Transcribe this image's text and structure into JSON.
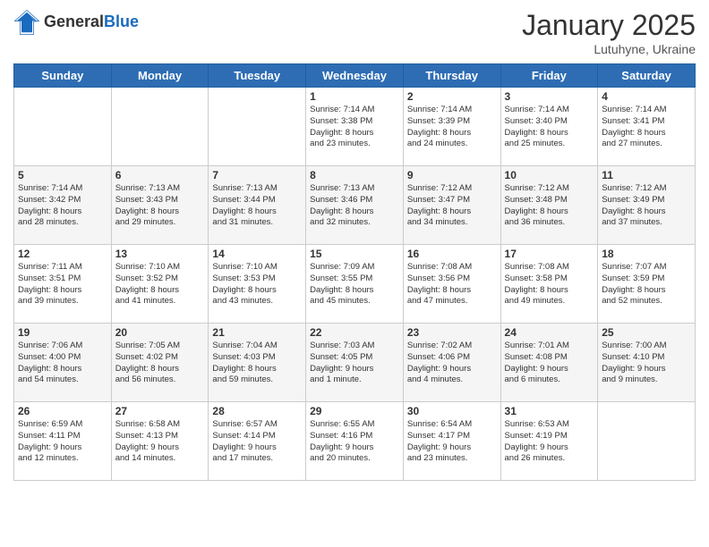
{
  "header": {
    "logo_general": "General",
    "logo_blue": "Blue",
    "month_title": "January 2025",
    "subtitle": "Lutuhyne, Ukraine"
  },
  "weekdays": [
    "Sunday",
    "Monday",
    "Tuesday",
    "Wednesday",
    "Thursday",
    "Friday",
    "Saturday"
  ],
  "weeks": [
    [
      {
        "day": "",
        "info": ""
      },
      {
        "day": "",
        "info": ""
      },
      {
        "day": "",
        "info": ""
      },
      {
        "day": "1",
        "info": "Sunrise: 7:14 AM\nSunset: 3:38 PM\nDaylight: 8 hours\nand 23 minutes."
      },
      {
        "day": "2",
        "info": "Sunrise: 7:14 AM\nSunset: 3:39 PM\nDaylight: 8 hours\nand 24 minutes."
      },
      {
        "day": "3",
        "info": "Sunrise: 7:14 AM\nSunset: 3:40 PM\nDaylight: 8 hours\nand 25 minutes."
      },
      {
        "day": "4",
        "info": "Sunrise: 7:14 AM\nSunset: 3:41 PM\nDaylight: 8 hours\nand 27 minutes."
      }
    ],
    [
      {
        "day": "5",
        "info": "Sunrise: 7:14 AM\nSunset: 3:42 PM\nDaylight: 8 hours\nand 28 minutes."
      },
      {
        "day": "6",
        "info": "Sunrise: 7:13 AM\nSunset: 3:43 PM\nDaylight: 8 hours\nand 29 minutes."
      },
      {
        "day": "7",
        "info": "Sunrise: 7:13 AM\nSunset: 3:44 PM\nDaylight: 8 hours\nand 31 minutes."
      },
      {
        "day": "8",
        "info": "Sunrise: 7:13 AM\nSunset: 3:46 PM\nDaylight: 8 hours\nand 32 minutes."
      },
      {
        "day": "9",
        "info": "Sunrise: 7:12 AM\nSunset: 3:47 PM\nDaylight: 8 hours\nand 34 minutes."
      },
      {
        "day": "10",
        "info": "Sunrise: 7:12 AM\nSunset: 3:48 PM\nDaylight: 8 hours\nand 36 minutes."
      },
      {
        "day": "11",
        "info": "Sunrise: 7:12 AM\nSunset: 3:49 PM\nDaylight: 8 hours\nand 37 minutes."
      }
    ],
    [
      {
        "day": "12",
        "info": "Sunrise: 7:11 AM\nSunset: 3:51 PM\nDaylight: 8 hours\nand 39 minutes."
      },
      {
        "day": "13",
        "info": "Sunrise: 7:10 AM\nSunset: 3:52 PM\nDaylight: 8 hours\nand 41 minutes."
      },
      {
        "day": "14",
        "info": "Sunrise: 7:10 AM\nSunset: 3:53 PM\nDaylight: 8 hours\nand 43 minutes."
      },
      {
        "day": "15",
        "info": "Sunrise: 7:09 AM\nSunset: 3:55 PM\nDaylight: 8 hours\nand 45 minutes."
      },
      {
        "day": "16",
        "info": "Sunrise: 7:08 AM\nSunset: 3:56 PM\nDaylight: 8 hours\nand 47 minutes."
      },
      {
        "day": "17",
        "info": "Sunrise: 7:08 AM\nSunset: 3:58 PM\nDaylight: 8 hours\nand 49 minutes."
      },
      {
        "day": "18",
        "info": "Sunrise: 7:07 AM\nSunset: 3:59 PM\nDaylight: 8 hours\nand 52 minutes."
      }
    ],
    [
      {
        "day": "19",
        "info": "Sunrise: 7:06 AM\nSunset: 4:00 PM\nDaylight: 8 hours\nand 54 minutes."
      },
      {
        "day": "20",
        "info": "Sunrise: 7:05 AM\nSunset: 4:02 PM\nDaylight: 8 hours\nand 56 minutes."
      },
      {
        "day": "21",
        "info": "Sunrise: 7:04 AM\nSunset: 4:03 PM\nDaylight: 8 hours\nand 59 minutes."
      },
      {
        "day": "22",
        "info": "Sunrise: 7:03 AM\nSunset: 4:05 PM\nDaylight: 9 hours\nand 1 minute."
      },
      {
        "day": "23",
        "info": "Sunrise: 7:02 AM\nSunset: 4:06 PM\nDaylight: 9 hours\nand 4 minutes."
      },
      {
        "day": "24",
        "info": "Sunrise: 7:01 AM\nSunset: 4:08 PM\nDaylight: 9 hours\nand 6 minutes."
      },
      {
        "day": "25",
        "info": "Sunrise: 7:00 AM\nSunset: 4:10 PM\nDaylight: 9 hours\nand 9 minutes."
      }
    ],
    [
      {
        "day": "26",
        "info": "Sunrise: 6:59 AM\nSunset: 4:11 PM\nDaylight: 9 hours\nand 12 minutes."
      },
      {
        "day": "27",
        "info": "Sunrise: 6:58 AM\nSunset: 4:13 PM\nDaylight: 9 hours\nand 14 minutes."
      },
      {
        "day": "28",
        "info": "Sunrise: 6:57 AM\nSunset: 4:14 PM\nDaylight: 9 hours\nand 17 minutes."
      },
      {
        "day": "29",
        "info": "Sunrise: 6:55 AM\nSunset: 4:16 PM\nDaylight: 9 hours\nand 20 minutes."
      },
      {
        "day": "30",
        "info": "Sunrise: 6:54 AM\nSunset: 4:17 PM\nDaylight: 9 hours\nand 23 minutes."
      },
      {
        "day": "31",
        "info": "Sunrise: 6:53 AM\nSunset: 4:19 PM\nDaylight: 9 hours\nand 26 minutes."
      },
      {
        "day": "",
        "info": ""
      }
    ]
  ]
}
